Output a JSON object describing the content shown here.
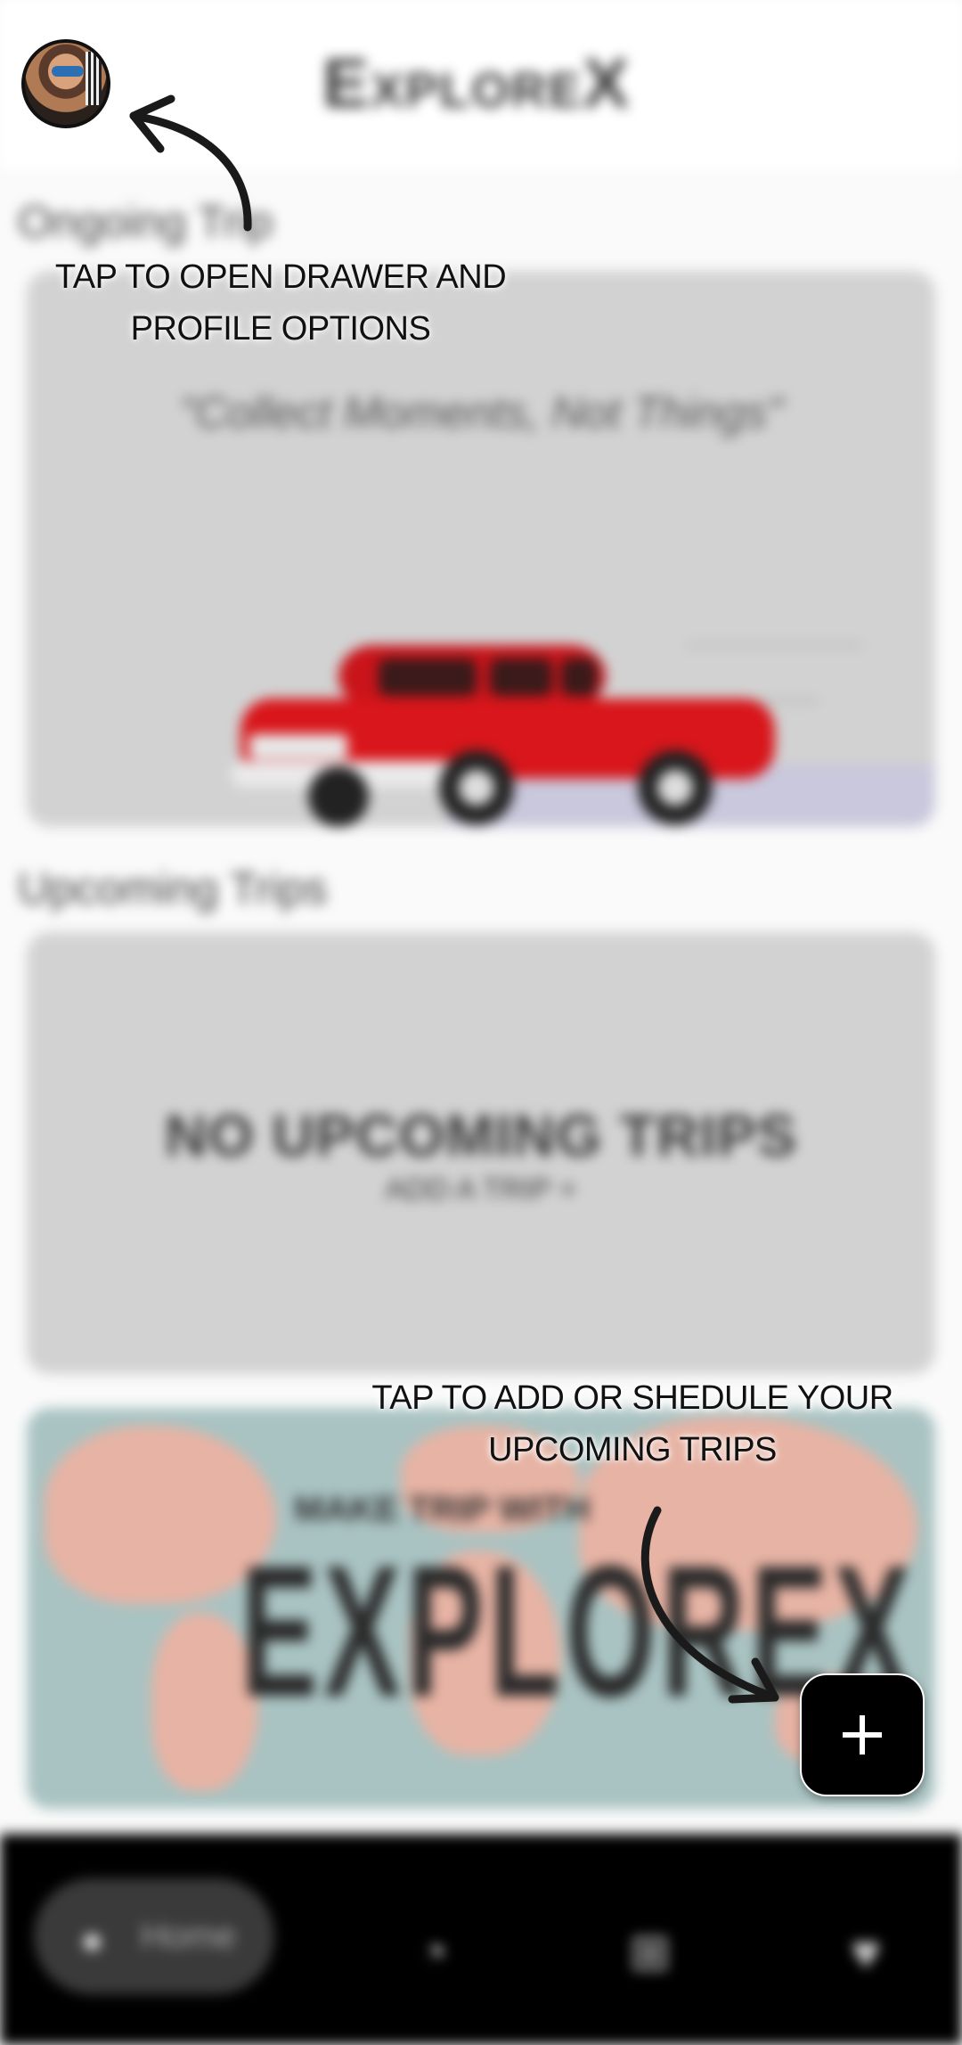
{
  "app": {
    "title": "ExploreX"
  },
  "sections": {
    "ongoing_title": "Ongoing Trip",
    "upcoming_title": "Upcoming Trips"
  },
  "ongoing_card": {
    "quote": "\"Collect Moments, Not Things\""
  },
  "upcoming_card": {
    "empty_title": "NO UPCOMING TRIPS",
    "empty_hint": "ADD A TRIP +"
  },
  "promo_card": {
    "subtitle": "MAKE TRIP WITH",
    "brand": "EXPLOREX"
  },
  "onboarding": {
    "drawer_hint_line1": "TAP TO OPEN DRAWER AND",
    "drawer_hint_line2": "PROFILE OPTIONS",
    "add_hint_line1": "TAP TO ADD OR SHEDULE YOUR",
    "add_hint_line2": "UPCOMING TRIPS"
  },
  "fab": {
    "icon": "plus-icon",
    "glyph": "+"
  },
  "bottom_nav": {
    "home_label": "Home",
    "items": [
      "home-icon",
      "history-icon",
      "add-box-icon",
      "favorite-icon"
    ]
  },
  "colors": {
    "card_gray": "#d2d2d2",
    "car_red": "#d8161b",
    "nav_bg": "#000000",
    "fab_bg": "#000000"
  }
}
